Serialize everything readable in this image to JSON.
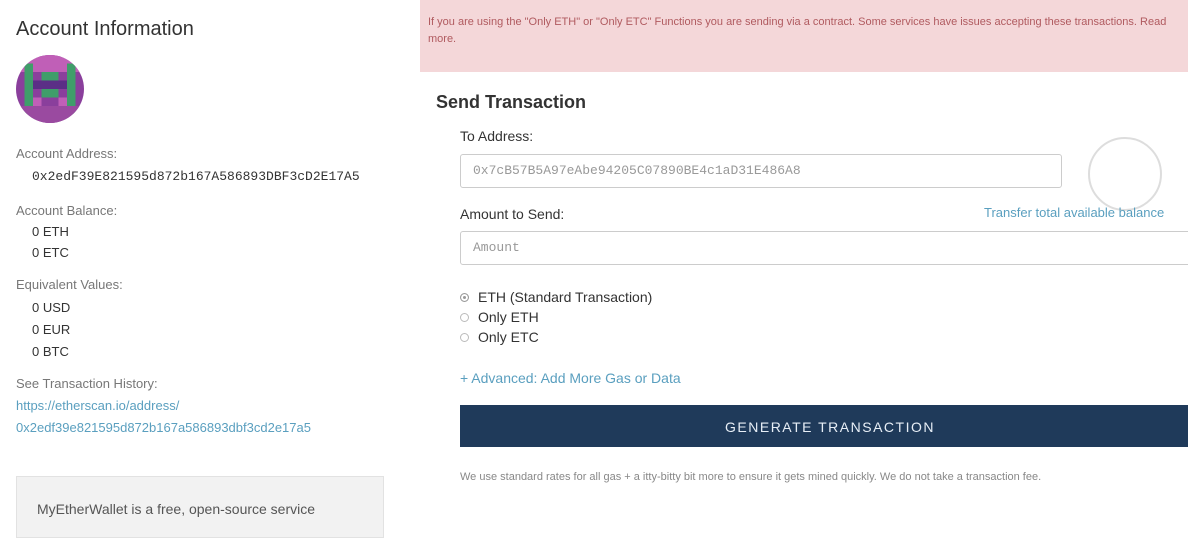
{
  "account": {
    "title": "Account Information",
    "address_label": "Account Address:",
    "address": "0x2edF39E821595d872b167A586893DBF3cD2E17A5",
    "balance_label": "Account Balance:",
    "balances": [
      "0 ETH",
      "0 ETC"
    ],
    "equivalent_label": "Equivalent Values:",
    "equivalents": [
      "0 USD",
      "0 EUR",
      "0 BTC"
    ],
    "history_label": "See Transaction History:",
    "history_link_line1": "https://etherscan.io/address/",
    "history_link_line2": "0x2edf39e821595d872b167a586893dbf3cd2e17a5",
    "info_text": "MyEtherWallet is a free, open-source service"
  },
  "alert": {
    "text": "If you are using the \"Only ETH\" or \"Only ETC\" Functions you are sending via a contract. Some services have issues accepting these transactions. Read more."
  },
  "send": {
    "title": "Send Transaction",
    "to_label": "To Address:",
    "to_value": "0x7cB57B5A97eAbe94205C07890BE4c1aD31E486A8",
    "amount_label": "Amount to Send:",
    "transfer_link": "Transfer total available balance",
    "amount_placeholder": "Amount",
    "options": [
      {
        "label": "ETH (Standard Transaction)",
        "checked": true
      },
      {
        "label": "Only ETH",
        "checked": false
      },
      {
        "label": "Only ETC",
        "checked": false
      }
    ],
    "advanced_link": "+ Advanced: Add More Gas or Data",
    "generate_button": "GENERATE TRANSACTION",
    "note": "We use standard rates for all gas + a itty-bitty bit more to ensure it gets mined quickly. We do not take a transaction fee."
  },
  "colors": {
    "link": "#5a9fbf",
    "alert_bg": "#f4d7d9",
    "alert_text": "#b05a5f",
    "button_bg": "#1f3a5a"
  }
}
